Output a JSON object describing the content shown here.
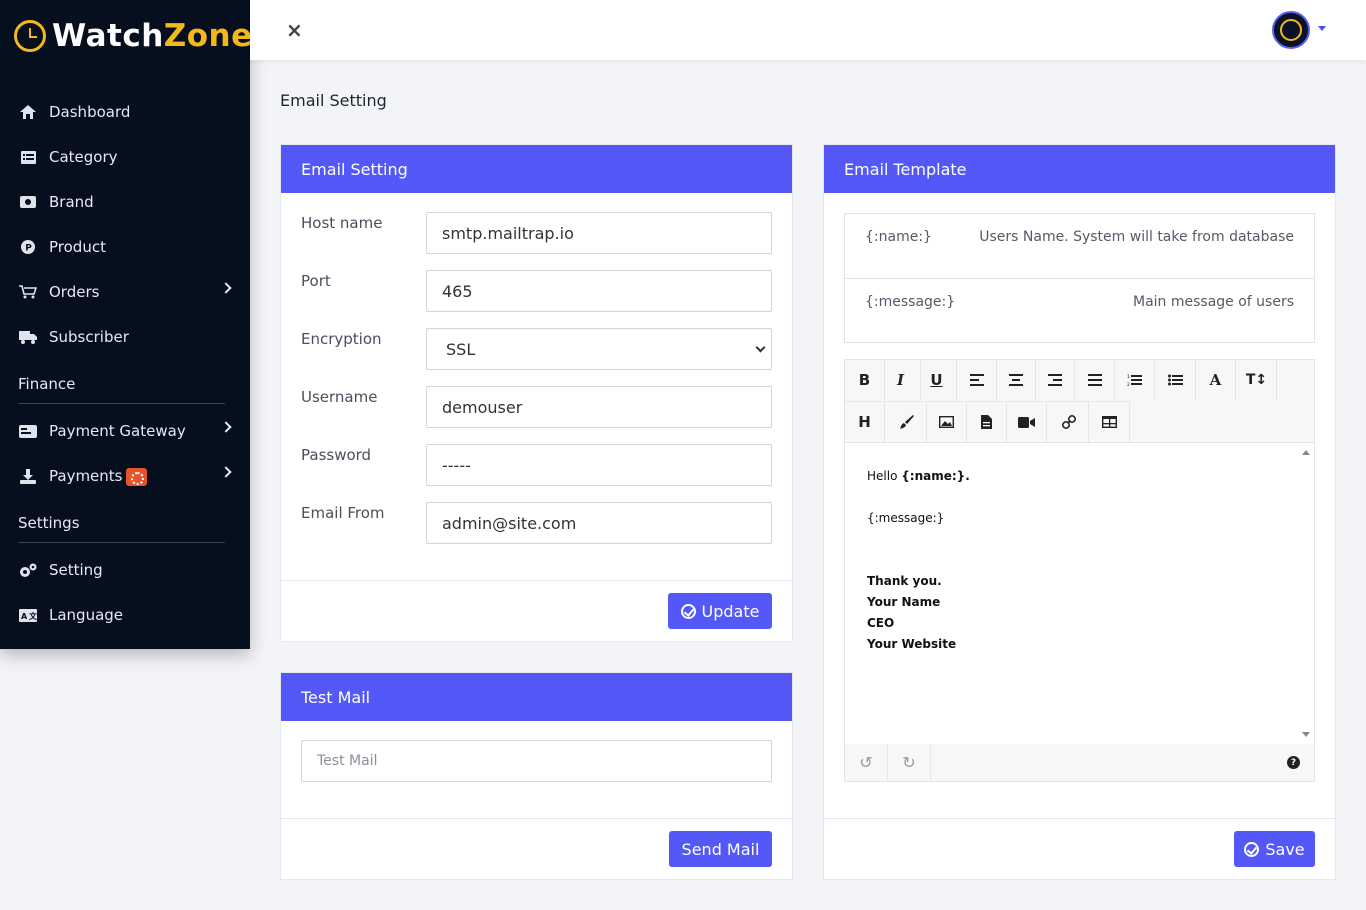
{
  "brand": {
    "part1": "Watch",
    "part2": "Zone"
  },
  "sidebar": {
    "items": [
      {
        "label": "Dashboard",
        "icon": "home-icon"
      },
      {
        "label": "Category",
        "icon": "list-icon"
      },
      {
        "label": "Brand",
        "icon": "money-icon"
      },
      {
        "label": "Product",
        "icon": "product-icon"
      },
      {
        "label": "Orders",
        "icon": "cart-icon"
      },
      {
        "label": "Subscriber",
        "icon": "truck-icon"
      },
      {
        "label": "Payment Gateway",
        "icon": "card-icon"
      },
      {
        "label": "Payments",
        "icon": "download-icon"
      },
      {
        "label": "Setting",
        "icon": "gears-icon"
      },
      {
        "label": "Language",
        "icon": "language-icon"
      }
    ],
    "sections": {
      "finance": "Finance",
      "settings": "Settings"
    }
  },
  "topbar": {
    "close": "×"
  },
  "page": {
    "title": "Email Setting"
  },
  "email_setting": {
    "title": "Email Setting",
    "fields": {
      "host_label": "Host name",
      "host_value": "smtp.mailtrap.io",
      "port_label": "Port",
      "port_value": "465",
      "encryption_label": "Encryption",
      "encryption_value": "SSL",
      "username_label": "Username",
      "username_value": "demouser",
      "password_label": "Password",
      "password_value": "-----",
      "from_label": "Email From",
      "from_value": "admin@site.com"
    },
    "update_button": "Update"
  },
  "test_mail": {
    "title": "Test Mail",
    "placeholder": "Test Mail",
    "send_button": "Send Mail"
  },
  "email_template": {
    "title": "Email Template",
    "variables": [
      {
        "key": "{:name:}",
        "desc": "Users Name. System will take from database"
      },
      {
        "key": "{:message:}",
        "desc": "Main message of users"
      }
    ],
    "body": {
      "greeting": "Hello ",
      "name_var": "{:name:}.",
      "message_var": "{:message:}",
      "thanks": "Thank you.",
      "your_name": "Your Name",
      "ceo": "CEO",
      "website": "Your Website"
    },
    "save_button": "Save"
  }
}
